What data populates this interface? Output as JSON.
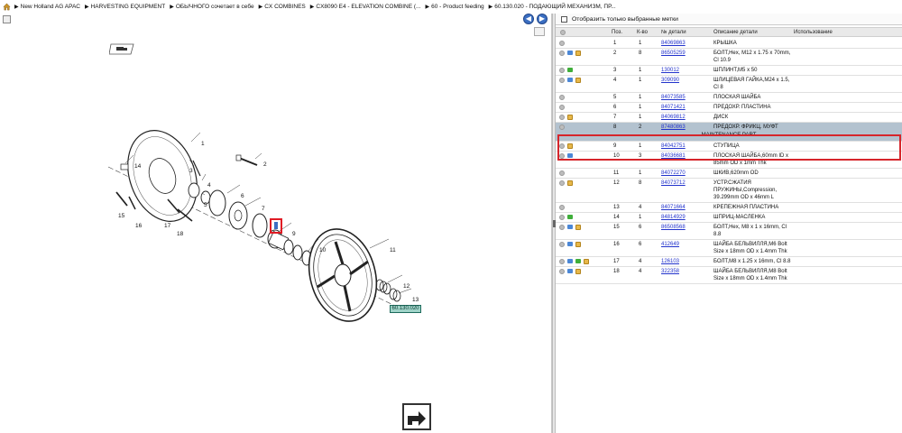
{
  "breadcrumb": {
    "items": [
      "New Holland AG APAC",
      "HARVESTING EQUIPMENT",
      "ОБЫЧНОГО сочетает в себе",
      "CX COMBINES",
      "CX8090 E4 - ELEVATION COMBINE (...",
      "60 - Product feeding",
      "60.130.020 - ПОДАЮЩИЙ МЕХАНИЗМ, ПР..."
    ]
  },
  "diagram": {
    "id_label": "60.130.020",
    "callouts": [
      "1",
      "2",
      "3",
      "4",
      "5",
      "6",
      "7",
      "8",
      "9",
      "10",
      "11",
      "12",
      "13",
      "14",
      "15",
      "16",
      "17",
      "18"
    ]
  },
  "filter": {
    "label": "Отобразить только выбранные метки"
  },
  "table": {
    "headers": {
      "pos": "Поз.",
      "qty": "К-во",
      "part": "№ детали",
      "desc": "Описание детали",
      "use": "Использование"
    },
    "rows": [
      {
        "pos": "1",
        "qty": "1",
        "part": "84069863",
        "desc": [
          "КРЫШКА"
        ],
        "icons": [
          "grey"
        ]
      },
      {
        "pos": "2",
        "qty": "8",
        "part": "86505259",
        "desc": [
          "БОЛТ,Hex, M12 x 1.75 x 70mm,",
          "Cl 10.9"
        ],
        "icons": [
          "grey",
          "blue",
          "box"
        ]
      },
      {
        "pos": "3",
        "qty": "1",
        "part": "130012",
        "desc": [
          "ШПЛИНТ,M5 x 50"
        ],
        "icons": [
          "grey",
          "green"
        ]
      },
      {
        "pos": "4",
        "qty": "1",
        "part": "309090",
        "desc": [
          "ШЛИЦЕВАЯ ГАЙКА,M24 x 1.5,",
          "Cl 8"
        ],
        "icons": [
          "grey",
          "blue",
          "box"
        ]
      },
      {
        "pos": "5",
        "qty": "1",
        "part": "84073585",
        "desc": [
          "ПЛОСКАЯ ШАЙБА"
        ],
        "icons": [
          "grey"
        ]
      },
      {
        "pos": "6",
        "qty": "1",
        "part": "84071421",
        "desc": [
          "ПРЕДОХР. ПЛАСТИНА"
        ],
        "icons": [
          "grey"
        ]
      },
      {
        "pos": "7",
        "qty": "1",
        "part": "84069812",
        "desc": [
          "ДИСК"
        ],
        "icons": [
          "grey",
          "box"
        ]
      },
      {
        "pos": "8",
        "qty": "2",
        "part": "87480863",
        "desc": [
          "ПРЕДОХР. ФРИКЦ. МУФТ"
        ],
        "icons": [
          "grey"
        ],
        "note": "MAINTENANCE PART"
      },
      {
        "pos": "9",
        "qty": "1",
        "part": "84042751",
        "desc": [
          "СТУПИЦА"
        ],
        "icons": [
          "grey",
          "box"
        ]
      },
      {
        "pos": "10",
        "qty": "3",
        "part": "84036681",
        "desc": [
          "ПЛОСКАЯ ШАЙБА,60mm ID x",
          "85mm OD x 1mm Thk"
        ],
        "icons": [
          "grey",
          "blue"
        ]
      },
      {
        "pos": "11",
        "qty": "1",
        "part": "84072270",
        "desc": [
          "ШКИВ,620mm OD"
        ],
        "icons": [
          "grey"
        ]
      },
      {
        "pos": "12",
        "qty": "8",
        "part": "84073712",
        "desc": [
          "УСТР.СЖАТИЯ",
          "ПРУЖИНЫ,Compression,",
          "39.299mm OD x 46mm L"
        ],
        "icons": [
          "grey",
          "box"
        ]
      },
      {
        "pos": "13",
        "qty": "4",
        "part": "84071664",
        "desc": [
          "КРЕПЕЖНАЯ ПЛАСТИНА"
        ],
        "icons": [
          "grey"
        ]
      },
      {
        "pos": "14",
        "qty": "1",
        "part": "84814929",
        "desc": [
          "ШПРИЦ-МАСЛЕНКА"
        ],
        "icons": [
          "grey",
          "green"
        ]
      },
      {
        "pos": "15",
        "qty": "6",
        "part": "86508568",
        "desc": [
          "БОЛТ,Hex, M8 x 1 x 16mm, Cl",
          "8.8"
        ],
        "icons": [
          "grey",
          "blue",
          "box"
        ]
      },
      {
        "pos": "16",
        "qty": "6",
        "part": "412649",
        "desc": [
          "ШАЙБА БЕЛЬВИЛЛЯ,M6 Bolt",
          "Size x 18mm OD x 1.4mm Thk"
        ],
        "icons": [
          "grey",
          "blue",
          "box"
        ]
      },
      {
        "pos": "17",
        "qty": "4",
        "part": "126103",
        "desc": [
          "БОЛТ,M8 x 1.25 x 16mm, Cl 8.8"
        ],
        "icons": [
          "grey",
          "blue",
          "green",
          "box"
        ]
      },
      {
        "pos": "18",
        "qty": "4",
        "part": "322358",
        "desc": [
          "ШАЙБА БЕЛЬВИЛЛЯ,M8 Bolt",
          "Size x 18mm OD x 1.4mm Thk"
        ],
        "icons": [
          "grey",
          "blue",
          "box"
        ]
      }
    ]
  },
  "colors": {
    "selected_row": "#b3c2cf",
    "highlight_border": "#d6252b",
    "link": "#2233cc"
  }
}
